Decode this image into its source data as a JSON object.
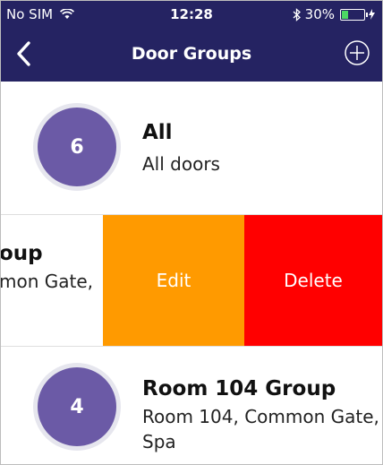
{
  "status_bar": {
    "carrier": "No SIM",
    "time": "12:28",
    "battery_percent": "30%",
    "battery_level": 0.3
  },
  "nav": {
    "title": "Door Groups",
    "back_icon": "chevron-left-icon",
    "add_icon": "plus-circle-icon"
  },
  "groups": [
    {
      "count": "6",
      "name": "All",
      "doors": "All doors"
    },
    {
      "name": "oup",
      "doors": "mon Gate,",
      "edit_label": "Edit",
      "delete_label": "Delete"
    },
    {
      "count": "4",
      "name": "Room 104 Group",
      "doors": "Room 104, Common Gate, Spa"
    }
  ],
  "colors": {
    "nav_background": "#252362",
    "avatar": "#6b5aa6",
    "edit": "#ff9a00",
    "delete": "#ff0000"
  }
}
